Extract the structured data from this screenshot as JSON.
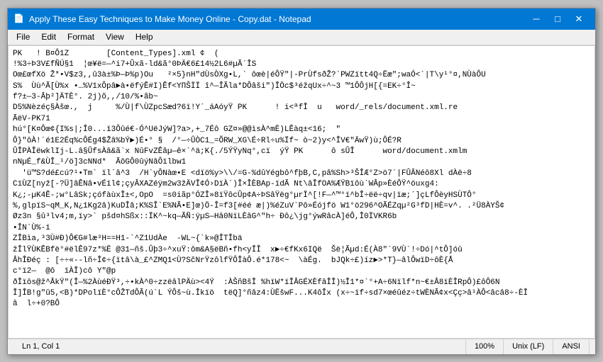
{
  "window": {
    "title": "Apply These Easy Techniques to Make Money Online - Copy.dat - Notepad",
    "title_icon": "📄"
  },
  "title_buttons": {
    "minimize": "─",
    "maximize": "□",
    "close": "✕"
  },
  "menu": {
    "items": [
      "File",
      "Edit",
      "Format",
      "View",
      "Help"
    ]
  },
  "content": "PK\u0003\u0004\u0000\u0000 ! B¤Ô1Z\u0000 \u0000 \u0000\u0000 \u0000[Content_Types].xml ¢\u0000 (\n!%3÷Þ3V£fÑÚ§1 \u0000¦œ¥ë=—^i7+Ûxã-\u0000ld&ã°0ÞÄ€6£14½2\u0000L6\u0000#µÃ´ÎS\nOœ£ œf\u0000Xö Ž*•V$z3,,\u0000û3à±%Þ\u0000—Þ%p)Ou\u0000\u0000^ \u0000\u0000²×5}nH\"\u0000dÙsÒXg•L,` \u0000ôœè|éÔŸ\"|-PrÙfsðŽ\u0000\u0000?`PWZ\u0000\u0000ïtt4Q÷Ëæ\";waÓ<`|T\\y¹°¤,NÙàÔU\nS%  Ùù^Ã[Ù%x •…%V1xÔpâ►à•ëfýÊ#I)Êf<YΠŠÏÏ\u0000î^\u0000—ÎÃ\u0000la*DÔâš\u0000i\")ÎÖc$³éžqUx÷^~3 \u0000™1ÔÔjH[{\u0000=EK÷°Î~\nf?±—3-Âþ²]ÄTÈ°. 2j)õ,\u0000\u0000/10/%•ãb~\nD5%Nèzéç§Àšœ.,  j     %/Ù|f\\ÙZpcSæd?6ï!Y´_á\u0000\u0000]Aó\u0000  yŸ\u0000 PK\u0003\u0004  \u0000    \u0000  ! i<ªfÎ  u\u0000  \u0000\u0000word/_rels/document.xml.re\nÃëV-\u0000PK71\nhú°\u0000[K¤Ôœ¢{I%s|;Î0...ï3Ôûé€-Ó^UëJýW\u0000\u0000]?a>,+\u0000_7Éô\u0000\u0000GZ\u0000¤»@@ìsÀ^mÈ\u0000\u0000)L\u0000Êàq±<16\u0000;  \"\nÔ}\"ôÀ!´é1E2Éq%cÔ\u0000Ég4$\u0000Ž)â%bÝ►)\u0000É•° §  /°—÷ÛÒC1_\u0000=ÕRW_\u0000XG\\É÷Rl÷u\u0000%\u0000Ï†~ ò~2)y<^\u0000ÎV€\"ÄwŸ)ù;ÔÉ?R\nÛÎ\u0000PÀ•\u0000ÎëwklIj-L.â§ÛfsÀâ&ã`x\u0000NûFvZÊâµ—ê×`^ä;K{./5\u0000ÝŸyNq°,cï  ýŸ\u0000 PK\u0003\u0004  \u0000  \u0000 \u0000  ô sÛÎ  \u0000\u0000  \u0000œ  word/document.xml\u0000\u0000m\nnNµÉ_f&ÙÎ_¹/ö\u0000]3cNNd*\u0000  ÃôGÔ0ûýNâÔï\u0000lbw1\n\u0000\u0000'ü™S?dé£cú?¹•Tm` ïl`â^3\u0000\u0000 /H`yÔNàœ•E <dïö%y>\u0000/=G-\u0000%dûYégbô^fþ\u0000B,C,pâ%Sh>³ŠÎÆ°Z>ö7´|FÛÂNé\u0000ô8Xl dÀë÷8\nCïÙZ[nyž\u0000\u0000[-?Ü]âÊNâ•vÉïl¢;çyÂXAZé\u0000\u0000¿m2w3žÄVÎ¢Ó›DïÀ´)Î×Î\u0000}ÈBAp-ïdÃ Nt\\â\u0000ÎfOA%ÆŸBïôù`WÂp»ÈéÔŸ^ö\u0000uxg4:\n\u0000K¿;-µK4Ê-\u0000;w°LâS\u0000k\u0000;çófà\u0000\u0000;ùxÎ±<,Op\u0000O  =s0iãp°ÓZÎ\u0000\u0000»8ïŸôc\u0000Ûp¢A÷ÞSâŸëg°µrÏ†\u0000^[!F—^™°ï^bÎ÷ëë÷qv\u0000|ïæ;´]çLfÔèyHSÙTÔ°\n%,gl\u0000pïS\u0000~qM_K,N¿1Kg2â)KuDÎâ;K%SÎ`E%NÃ\u0000•E\u0000]œ\u0000)Ö-Î\u0000=f3[#éé\u0000æ|)%éZuV\u0000`Pô»Éójfö\u0000W1°ö296^OÃÉZqµ²G³fD|HÈ=v^. .²Ü8ÀYŠ¢\n\u0000Ø]z3n §û³lv4;m,\u0000ïy>` pšd¤hSß\u0000x::ÏK^~kq—ÃÑ:ÿµS—Hâ0NïL\u0000ÈâG^\"\u0000h÷ \u0000Ðô¿\\jg°ýwRâcÀ\u0000]éÔ,\u0000Î0\u0000\u0000ÏVKR6\u0000\u0000\u0000b\n•ÎN`Ù%-ï\nZÎBìa,³3Ù\u0000#Ð)Ô€G#\u0000læ³H==H1-`^Z1UdÀe  -WL~\u0000{`k»@ÎT\u0000Îbä\nž\u0000ÎlŸÙKÊBfë°#ëlÊ97z*\u0000%Ë\u0000 @31—ñš.Ûþ3\u0000÷^xuŸ:ôm&A§ëBñ•fh<yÎÎ  x►÷€fKx6IQë  Šë¦Ãµ\u0000d:É(À8\"`9VÙ`!÷\u0000Dó|^tÔ\u0000]ó\u0000û\nÂhÎÐéç : [÷÷\u0000«-\u0000\u0000lñ\u0000÷Î¢÷{ïtâ\\à_£^ZΜQ1<Ù?SčNrŸzôlfŸÔÎàÔ.é*178<~\u0000 \\àÉg.\u0000\u0000  bJQk÷£)íz►>*T}—âlÔwï\u0000D÷ôÈ{Å\u0000\u0000\nc°ï2—  @ô\u0000ïÀÎ)c\u0000ô Y\"\u0000@p\nðÎ\u0000ïôs@ž^\u0000ÂkŸ\u0000\"(Î—%2ÀùéÐŸ³,÷•kÀ^0÷zzëâ\u0000lPÄù><4Ý  \u0000:ÀŠñBšÎ %hïW*ïÎÂGÉX\u0000ÈfâÎÎ)½Î1*\u0000¤`°+A÷6Nïlf*n~€±Â8ïÈ\u0000ÎRpÔ)£ôÔ6N\nΠ\u0000]ÎB!\u0000g\"\u0000û5,<B\u0000\u0000)*DPolïÈ°cÔŽT\u0000dÔÃ(ú`L ÝÔš~ù.Î\u0000kïö  tëQ\u0000]°ñâz4:Ù\u0000Ëšw\u0000F...K4ô\u0000\u0000\u0000Î\u0000x (x÷~\u0000ïf÷sd7×œéûéz÷tWÈNÃ¢x<Çç>â¹ÀÔ<âcâ8÷-ÈÎ\nâ\u0000\u0000\u0000l÷+0?BÔ",
  "status_bar": {
    "position": "Ln 1, Col 1",
    "zoom": "100%",
    "line_ending": "Unix (LF)",
    "encoding": "ANSI"
  }
}
